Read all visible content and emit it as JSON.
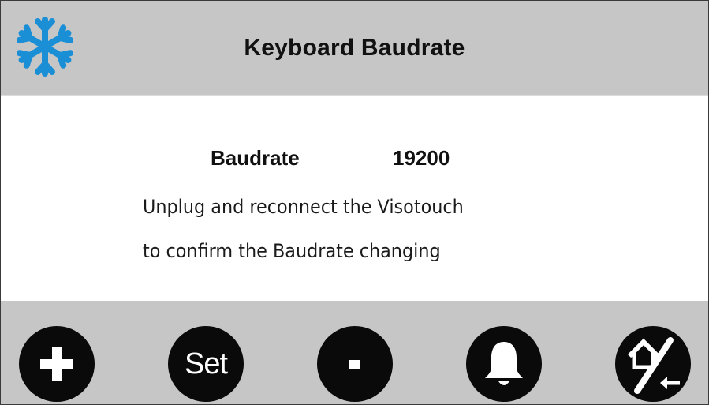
{
  "header": {
    "icon": "snowflake-icon",
    "title": "Keyboard Baudrate"
  },
  "main": {
    "baudrate_label": "Baudrate",
    "baudrate_value": "19200",
    "info_line_1": "Unplug and reconnect the Visotouch",
    "info_line_2": "to confirm the Baudrate changing"
  },
  "footer": {
    "buttons": [
      {
        "name": "plus-button",
        "icon": "plus-icon"
      },
      {
        "name": "set-button",
        "label": "Set"
      },
      {
        "name": "minus-button",
        "icon": "minus-icon"
      },
      {
        "name": "alarm-button",
        "icon": "bell-icon"
      },
      {
        "name": "home-back-button",
        "icon": "home-back-icon"
      }
    ]
  },
  "colors": {
    "bar_background": "#c6c6c6",
    "content_background": "#ffffff",
    "button_fill": "#0a0a0a",
    "icon_accent": "#1a8fd6",
    "text": "#111111"
  }
}
